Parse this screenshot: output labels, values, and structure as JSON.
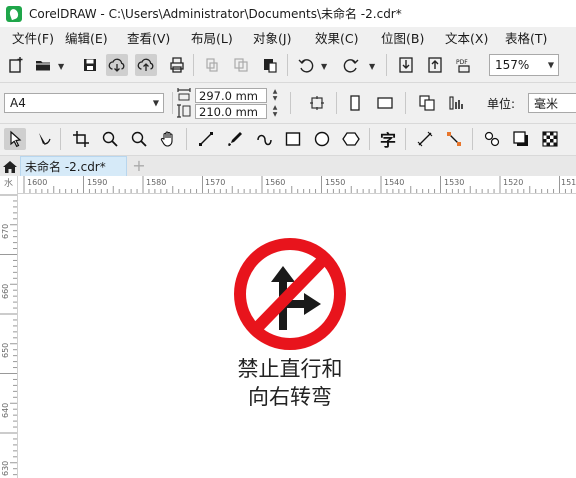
{
  "window": {
    "title": "CorelDRAW - C:\\Users\\Administrator\\Documents\\未命名 -2.cdr*"
  },
  "menu": [
    "文件(F)",
    "编辑(E)",
    "查看(V)",
    "布局(L)",
    "对象(J)",
    "效果(C)",
    "位图(B)",
    "文本(X)",
    "表格(T)"
  ],
  "toolbar": {
    "zoom": "157%"
  },
  "property_bar": {
    "page_size": "A4",
    "width": "297.0 mm",
    "height": "210.0 mm",
    "units_label": "单位:",
    "units_value": "毫米"
  },
  "tabs": {
    "document": "未命名 -2.cdr*",
    "add": "+"
  },
  "ruler": {
    "corner": "水",
    "h_labels": [
      "1600",
      "1590",
      "1580",
      "1570",
      "1560",
      "1550",
      "1540",
      "1530",
      "1520",
      "151"
    ],
    "v_labels": [
      "670",
      "660",
      "650",
      "640",
      "630"
    ]
  },
  "sign": {
    "caption_line1": "禁止直行和",
    "caption_line2": "向右转弯",
    "ring_color": "#e8141c",
    "arrow_color": "#1a1a1a"
  },
  "icons": [
    "new-document-icon",
    "open-folder-icon",
    "save-icon",
    "cloud-download-icon",
    "cloud-upload-icon",
    "print-icon",
    "cut-icon",
    "copy-icon",
    "paste-icon",
    "undo-icon",
    "redo-icon",
    "import-icon",
    "export-icon",
    "pdf-icon",
    "portrait-icon",
    "landscape-icon",
    "all-pages-icon",
    "current-page-icon",
    "pick-tool-icon",
    "shape-tool-icon",
    "crop-tool-icon",
    "zoom-tool-icon",
    "pan-tool-icon",
    "freehand-tool-icon",
    "artistic-media-icon",
    "rectangle-tool-icon",
    "ellipse-tool-icon",
    "polygon-tool-icon",
    "text-tool-icon",
    "dimension-tool-icon",
    "connector-tool-icon",
    "shadow-tool-icon",
    "transparency-tool-icon",
    "fill-tool-icon",
    "home-icon"
  ]
}
